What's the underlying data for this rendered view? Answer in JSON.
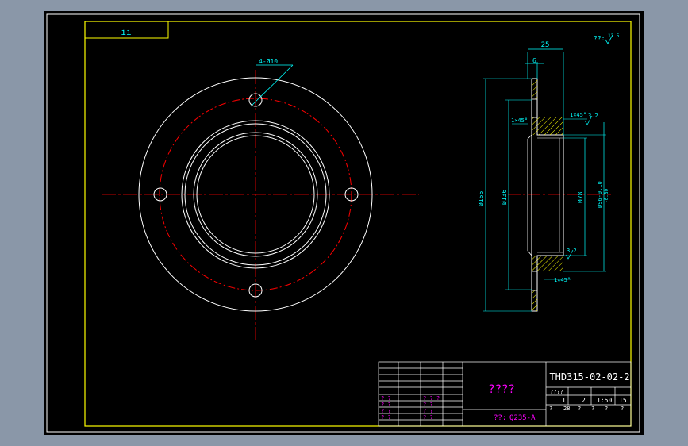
{
  "colors": {
    "background_grey": "#8a97a8",
    "canvas": "#000000",
    "frame": "#ffff00",
    "geometry": "#ffffff",
    "centerline": "#ff0000",
    "dimension": "#00ffff",
    "hatch": "#ffff00",
    "title_text": "#ff00ff"
  },
  "top_left_tag": "ii",
  "roughness_note": "??:",
  "roughness_value": "12.5",
  "front_view": {
    "hole_callout": "4-Ø10"
  },
  "section_view": {
    "dim_width": "25",
    "dim_flange": "6",
    "chamfer_outer_top": "1×45°",
    "chamfer_inner_top": "1×45°",
    "roughness_top": "3.2",
    "roughness_bottom": "3.2",
    "chamfer_bottom": "1×45°",
    "dia_166": "Ø166",
    "dia_136": "Ø136",
    "dia_78": "Ø78",
    "dia_96": "Ø96-0.10",
    "dia_96_lower": "-0.80"
  },
  "title_block": {
    "drawing_number": "THD315-02-02-2",
    "part_name": "????",
    "material_label": "??:",
    "material": "Q235-A",
    "scale_header": "????",
    "qty": "1",
    "sheet": "2",
    "scale": "1:50",
    "weight": "15",
    "left_q": [
      "? ?",
      "? ?",
      "? ?",
      "? ?"
    ],
    "mid_q": [
      "? ? ?",
      "? ?",
      "? ?",
      "? ?"
    ],
    "bottom_row": [
      "?",
      "28",
      "?",
      "?",
      "?",
      "?"
    ]
  }
}
